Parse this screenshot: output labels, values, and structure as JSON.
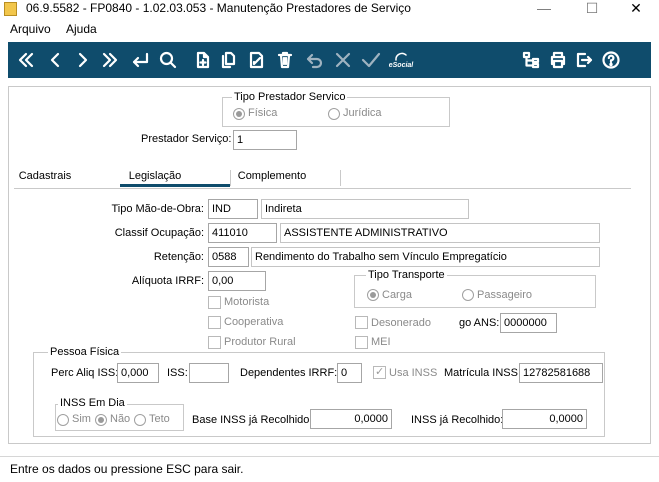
{
  "window": {
    "title": "06.9.5582 - FP0840 - 1.02.03.053 - Manutenção Prestadores de Serviço",
    "minimize": "—",
    "maximize": "☐",
    "close": "✕"
  },
  "menu": {
    "items": [
      "Arquivo",
      "Ajuda"
    ]
  },
  "toolbar": {
    "accent": "#0f4c6c",
    "icons": [
      "first-icon",
      "prev-icon",
      "next-icon",
      "last-icon",
      "enter-icon",
      "search-icon",
      "new-icon",
      "copy-icon",
      "edit-icon",
      "delete-icon",
      "undo-icon",
      "cancel-icon",
      "confirm-icon",
      "esocial-icon",
      "tree-icon",
      "print-icon",
      "exit-icon",
      "help-icon"
    ],
    "esocial_label": "eSocial"
  },
  "tipo_prestador": {
    "title": "Tipo Prestador Servico",
    "options": [
      "Física",
      "Jurídica"
    ],
    "selected": "Física"
  },
  "prestador": {
    "label": "Prestador Serviço:",
    "value": "1"
  },
  "tabs": {
    "items": [
      "Cadastrais",
      "Legislação",
      "Complemento"
    ],
    "active": "Legislação"
  },
  "legislacao": {
    "tipo_mao_obra": {
      "label": "Tipo Mão-de-Obra:",
      "code": "IND",
      "description": "Indireta"
    },
    "classif_ocupacao": {
      "label": "Classif Ocupação:",
      "code": "411010",
      "description": "ASSISTENTE ADMINISTRATIVO"
    },
    "retencao": {
      "label": "Retenção:",
      "code": "0588",
      "description": "Rendimento do Trabalho sem Vínculo Empregatício"
    },
    "aliquota_irrf": {
      "label": "Alíquota IRRF:",
      "value": "0,00"
    },
    "tipo_transporte": {
      "title": "Tipo Transporte",
      "options": [
        "Carga",
        "Passageiro"
      ],
      "selected": "Carga"
    },
    "checks": {
      "motorista": {
        "label": "Motorista",
        "checked": false
      },
      "cooperativa": {
        "label": "Cooperativa",
        "checked": false
      },
      "produtor_rural": {
        "label": "Produtor Rural",
        "checked": false
      },
      "desonerado": {
        "label": "Desonerado",
        "checked": false
      },
      "mei": {
        "label": "MEI",
        "checked": false
      }
    },
    "go_ans": {
      "label": "go ANS:",
      "value": "0000000"
    }
  },
  "pessoa_fisica": {
    "title": "Pessoa Física",
    "perc_aliq_iss": {
      "label": "Perc Aliq ISS:",
      "value": "0,000"
    },
    "iss": {
      "label": "ISS:",
      "value": ""
    },
    "dependentes_irrf": {
      "label": "Dependentes IRRF:",
      "value": "0"
    },
    "usa_inss": {
      "label": "Usa INSS",
      "checked": true
    },
    "matricula_inss": {
      "label": "Matrícula INSS:",
      "value": "12782581688"
    },
    "inss_em_dia": {
      "title": "INSS Em Dia",
      "options": [
        "Sim",
        "Não",
        "Teto"
      ],
      "selected": "Não"
    },
    "base_inss": {
      "label": "Base INSS já Recolhido:",
      "value": "0,0000"
    },
    "inss_recolhido": {
      "label": "INSS já Recolhido:",
      "value": "0,0000"
    }
  },
  "status": {
    "text": "Entre os dados ou pressione ESC para sair."
  }
}
